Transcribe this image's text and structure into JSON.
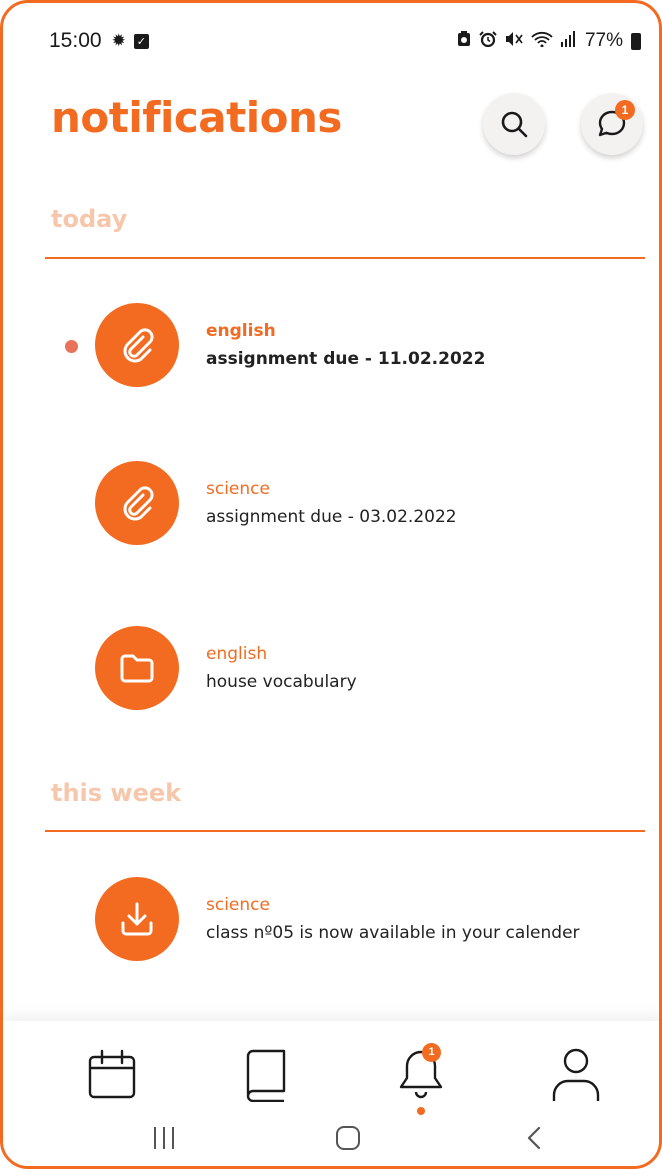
{
  "status_bar": {
    "time": "15:00",
    "battery": "77%",
    "icons": [
      "settings-gear-icon",
      "checkbox-icon",
      "battery-saver-icon",
      "alarm-icon",
      "mute-icon",
      "wifi-icon",
      "signal-icon",
      "battery-icon"
    ]
  },
  "header": {
    "title": "notifications",
    "search_icon": "search-icon",
    "chat_icon": "chat-bubble-icon",
    "chat_badge": "1"
  },
  "sections": [
    {
      "label": "today",
      "items": [
        {
          "subject": "english",
          "text": "assignment due - 11.02.2022",
          "icon": "paperclip-icon",
          "unread": true
        },
        {
          "subject": "science",
          "text": "assignment due - 03.02.2022",
          "icon": "paperclip-icon",
          "unread": false
        },
        {
          "subject": "english",
          "text": "house vocabulary",
          "icon": "folder-icon",
          "unread": false
        }
      ]
    },
    {
      "label": "this week",
      "items": [
        {
          "subject": "science",
          "text": "class nº05 is now available in your calender",
          "icon": "download-icon",
          "unread": false
        }
      ]
    }
  ],
  "bottom_nav": {
    "items": [
      "calendar-icon",
      "book-icon",
      "bell-icon",
      "profile-icon"
    ],
    "active": "bell-icon",
    "bell_badge": "1"
  },
  "system_nav": [
    "recent-apps-icon",
    "home-icon",
    "back-icon"
  ],
  "colors": {
    "accent": "#F26B21",
    "section_label": "#F7C7AC",
    "unread_dot": "#E8735A"
  }
}
